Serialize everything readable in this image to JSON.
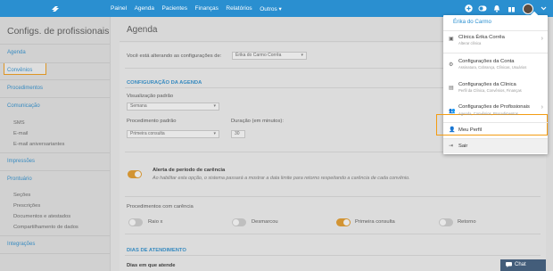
{
  "topnav": {
    "items": [
      "Painel",
      "Agenda",
      "Pacientes",
      "Finanças",
      "Relatórios",
      "Outros ▾"
    ]
  },
  "sidebar": {
    "title": "Configs. de profissionais",
    "active": "Agenda",
    "sections": [
      "Convênios",
      "Procedimentos",
      "Comunicação",
      "Impressões",
      "Prontuário",
      "Integrações"
    ],
    "comunicacao": [
      "SMS",
      "E-mail",
      "E-mail aniversariantes"
    ],
    "prontuario": [
      "Seções",
      "Prescrições",
      "Documentos e atestados",
      "Compartilhamento de dados"
    ]
  },
  "main": {
    "title": "Agenda",
    "editing_label": "Você está alterando as configurações de:",
    "editing_value": "Érika do Carmo Corrêa",
    "config_head": "CONFIGURAÇÃO DA AGENDA",
    "view_label": "Visualização padrão",
    "view_value": "Semana",
    "proc_label": "Procedimento padrão",
    "proc_value": "Primeira consulta",
    "duration_label": "Duração (em minutos):",
    "duration_value": "30",
    "alert_title": "Alerta de período de carência",
    "alert_desc": "Ao habilitar esta opção, o sistema passará a mostrar a data limite para retorno respeitando a carência de cada convênio.",
    "proc_carencia_label": "Procedimentos com carência",
    "toggles": [
      "Raio x",
      "Desmarcou",
      "Primeira consulta",
      "Retorno"
    ],
    "days_head": "DIAS DE ATENDIMENTO",
    "days_label": "Dias em que atende"
  },
  "dropdown": {
    "name": "Érika do Carmo",
    "items": [
      {
        "title": "Clínica Érika Corrêa",
        "sub": "Alterar clínica"
      },
      {
        "title": "Configurações da Conta",
        "sub": "Assinatura, Cobrança, Clínicas, Usuários"
      },
      {
        "title": "Configurações da Clínica",
        "sub": "Perfil da Clínica, Convênios, Finanças"
      },
      {
        "title": "Configurações de Profissionais",
        "sub": "Agenda, Convênios, Procedimentos"
      },
      {
        "title": "Meu Perfil",
        "sub": ""
      },
      {
        "title": "Sair",
        "sub": ""
      }
    ]
  },
  "chat": {
    "label": "Chat"
  },
  "colors": {
    "topbar": "#2a8fd0",
    "accent": "#f39c12",
    "toggle_on": "#e69a24"
  }
}
